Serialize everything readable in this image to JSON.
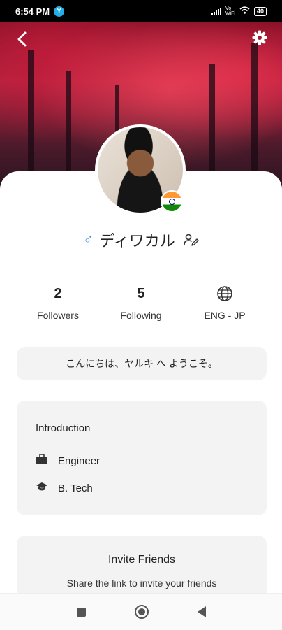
{
  "status_bar": {
    "time": "6:54 PM",
    "app_icon_letter": "Y",
    "network_label": "Vo\nWiFi",
    "battery": "40"
  },
  "profile": {
    "gender_symbol": "♂",
    "name": "ディワカル",
    "country_flag": "india-flag"
  },
  "stats": {
    "followers_value": "2",
    "followers_label": "Followers",
    "following_value": "5",
    "following_label": "Following",
    "language_label": "ENG - JP"
  },
  "greeting": "こんにちは、ヤルキ へ ようこそ。",
  "introduction": {
    "title": "Introduction",
    "items": [
      {
        "icon": "briefcase-icon",
        "label": "Engineer"
      },
      {
        "icon": "graduation-cap-icon",
        "label": "B. Tech"
      }
    ]
  },
  "invite": {
    "title": "Invite Friends",
    "subtitle": "Share the link to invite your friends"
  },
  "colors": {
    "accent_gender": "#3a8fd6",
    "card_bg": "#f3f3f3",
    "cover_red": "#b3223f"
  }
}
